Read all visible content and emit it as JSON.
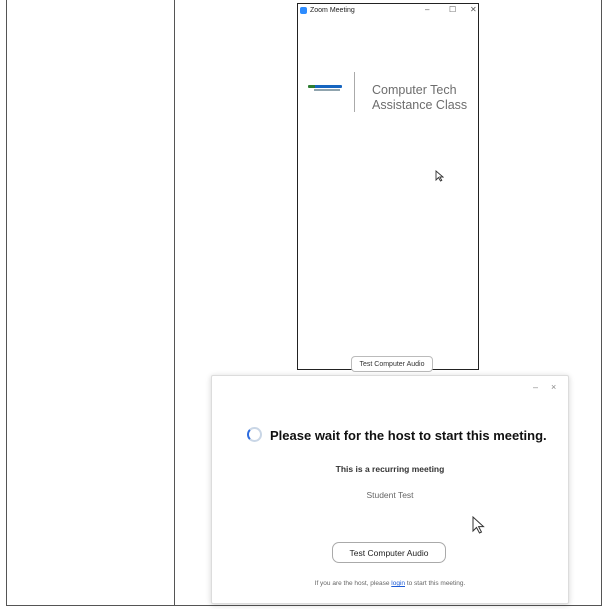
{
  "zoom_window": {
    "title": "Zoom Meeting",
    "controls": {
      "minimize": "–",
      "maximize": "☐",
      "close": "✕"
    },
    "class_name_line1": "Computer Tech",
    "class_name_line2": "Assistance Class",
    "test_audio_label": "Test Computer Audio"
  },
  "wait_dialog": {
    "controls": {
      "minimize": "–",
      "close": "×"
    },
    "headline": "Please wait for the host to start this meeting.",
    "recurring_text": "This is a recurring meeting",
    "topic": "Student Test",
    "test_audio_label": "Test Computer Audio",
    "host_prefix": "If you are the host, please",
    "login_link": "login",
    "host_suffix": "to start this meeting."
  },
  "colors": {
    "zoom_blue": "#2d8cff",
    "link_blue": "#1b5ad6"
  }
}
